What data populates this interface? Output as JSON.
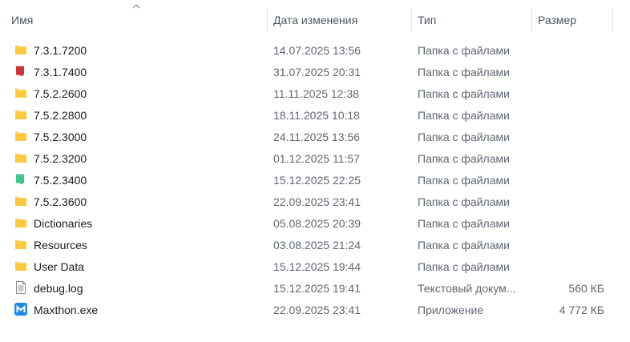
{
  "columns": {
    "name": "Имя",
    "date": "Дата изменения",
    "type": "Тип",
    "size": "Размер"
  },
  "sort": {
    "column": "name",
    "direction": "ascending"
  },
  "files": [
    {
      "name": "7.3.1.7200",
      "date": "14.07.2025 13:56",
      "type": "Папка с файлами",
      "size": "",
      "icon": "folder-icon",
      "color": "#ffc83d"
    },
    {
      "name": "7.3.1.7400",
      "date": "31.07.2025 20:31",
      "type": "Папка с файлами",
      "size": "",
      "icon": "folder-red-icon",
      "color": "#d13438"
    },
    {
      "name": "7.5.2.2600",
      "date": "11.11.2025 12:38",
      "type": "Папка с файлами",
      "size": "",
      "icon": "folder-icon",
      "color": "#ffc83d"
    },
    {
      "name": "7.5.2.2800",
      "date": "18.11.2025 10:18",
      "type": "Папка с файлами",
      "size": "",
      "icon": "folder-icon",
      "color": "#ffc83d"
    },
    {
      "name": "7.5.2.3000",
      "date": "24.11.2025 13:56",
      "type": "Папка с файлами",
      "size": "",
      "icon": "folder-icon",
      "color": "#ffc83d"
    },
    {
      "name": "7.5.2.3200",
      "date": "01.12.2025 11:57",
      "type": "Папка с файлами",
      "size": "",
      "icon": "folder-icon",
      "color": "#ffc83d"
    },
    {
      "name": "7.5.2.3400",
      "date": "15.12.2025 22:25",
      "type": "Папка с файлами",
      "size": "",
      "icon": "folder-green-icon",
      "color": "#3cc68a"
    },
    {
      "name": "7.5.2.3600",
      "date": "22.09.2025 23:41",
      "type": "Папка с файлами",
      "size": "",
      "icon": "folder-icon",
      "color": "#ffc83d"
    },
    {
      "name": "Dictionaries",
      "date": "05.08.2025 20:39",
      "type": "Папка с файлами",
      "size": "",
      "icon": "folder-icon",
      "color": "#ffc83d"
    },
    {
      "name": "Resources",
      "date": "03.08.2025 21:24",
      "type": "Папка с файлами",
      "size": "",
      "icon": "folder-icon",
      "color": "#ffc83d"
    },
    {
      "name": "User Data",
      "date": "15.12.2025 19:44",
      "type": "Папка с файлами",
      "size": "",
      "icon": "folder-icon",
      "color": "#ffc83d"
    },
    {
      "name": "debug.log",
      "date": "15.12.2025 19:41",
      "type": "Текстовый докум...",
      "size": "560 КБ",
      "icon": "text-file-icon",
      "color": "#9a9a9a"
    },
    {
      "name": "Maxthon.exe",
      "date": "22.09.2025 23:41",
      "type": "Приложение",
      "size": "4 772 КБ",
      "icon": "maxthon-app-icon",
      "color": "#1e88e5"
    }
  ]
}
